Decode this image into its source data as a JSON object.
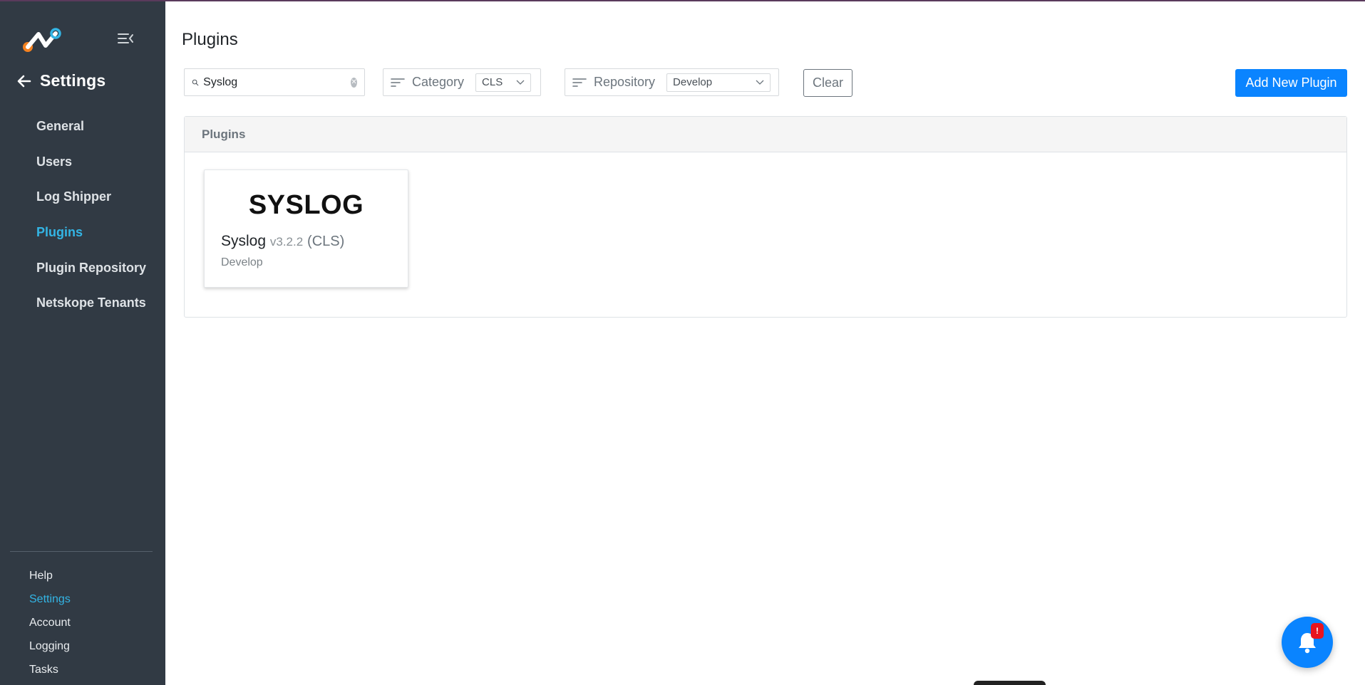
{
  "sidebar": {
    "back_title": "Settings",
    "nav": [
      "General",
      "Users",
      "Log Shipper",
      "Plugins",
      "Plugin Repository",
      "Netskope Tenants"
    ],
    "active_nav": "Plugins",
    "bottom_nav": [
      "Help",
      "Settings",
      "Account",
      "Logging",
      "Tasks"
    ],
    "active_bottom": "Settings"
  },
  "main": {
    "title": "Plugins",
    "search": {
      "value": "Syslog",
      "placeholder": "Search"
    },
    "category_filter": {
      "label": "Category",
      "value": "CLS"
    },
    "repository_filter": {
      "label": "Repository",
      "value": "Develop"
    },
    "clear_label": "Clear",
    "add_label": "Add New Plugin",
    "panel_title": "Plugins",
    "plugins": [
      {
        "logo_text": "SYSLOG",
        "name": "Syslog",
        "version": "v3.2.2",
        "category": "(CLS)",
        "repository": "Develop"
      }
    ]
  },
  "notifications": {
    "badge": "!"
  },
  "colors": {
    "sidebar_bg": "#313a44",
    "accent": "#33b5e5",
    "primary": "#0a84ff",
    "badge": "#e8141e"
  },
  "icons": [
    "logo",
    "collapse-menu-icon",
    "arrow-left-icon",
    "search-icon",
    "clear-icon",
    "sort-icon",
    "chevron-down-icon",
    "bell-icon"
  ]
}
